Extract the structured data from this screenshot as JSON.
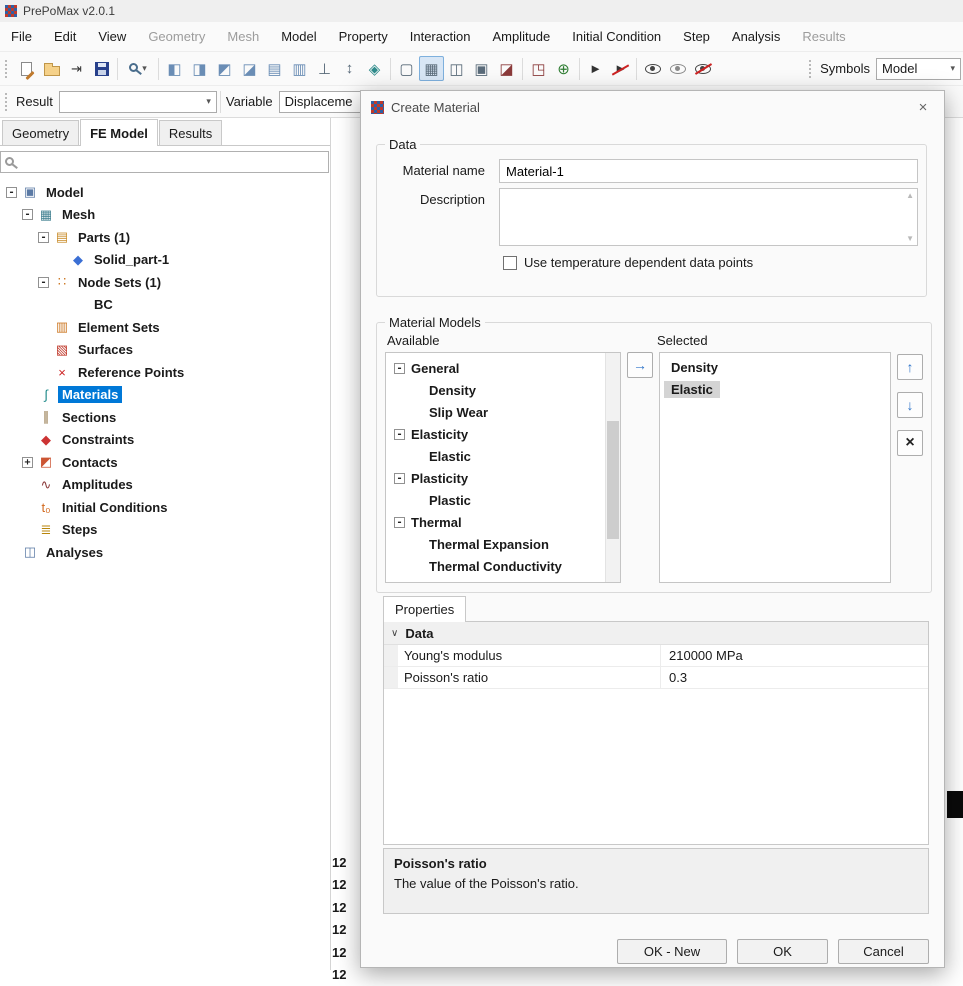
{
  "window": {
    "title": "PrePoMax v2.0.1"
  },
  "colors": {
    "selection_bg": "#0078d7",
    "selection_text": "#ffffff",
    "inactive_selection_bg": "#d4d4d4",
    "toolbar_selected_bg": "#d8e6f5"
  },
  "icons": {
    "app_logo": "css:red-blue-checker",
    "new_file": "css:page-pencil",
    "open_file": "css:folder",
    "import": "⇥",
    "save": "css:floppy",
    "zoom": "css:magnifier",
    "dropdown_caret": "▾",
    "front_view": "◧",
    "back_view": "◨",
    "left_view": "◩",
    "right_view": "◪",
    "top_view": "▤",
    "bottom_view": "▥",
    "normal_view": "⊥",
    "fit_view": "↕",
    "isometric_view": "◈",
    "wireframe_edges": "▢",
    "element_edges": "▦",
    "model_edges": "◫",
    "feature_edges": "▣",
    "section_view": "◪",
    "explode_parts": "◳",
    "query": "⊕",
    "annotate": "►",
    "remove_annotations": "►",
    "show": "css:eye",
    "transparency": "css:eye-faint",
    "hide": "css:eye-slash",
    "search": "css:magnifier",
    "close": "×",
    "scroll_up": "▲",
    "scroll_down": "▼",
    "add_model": "→",
    "move_up": "↑",
    "move_down": "↓",
    "delete_model": "×",
    "category_collapse": "∨"
  },
  "menu": {
    "items": [
      {
        "label": "File",
        "disabled": false
      },
      {
        "label": "Edit",
        "disabled": false
      },
      {
        "label": "View",
        "disabled": false
      },
      {
        "label": "Geometry",
        "disabled": true
      },
      {
        "label": "Mesh",
        "disabled": true
      },
      {
        "label": "Model",
        "disabled": false
      },
      {
        "label": "Property",
        "disabled": false
      },
      {
        "label": "Interaction",
        "disabled": false
      },
      {
        "label": "Amplitude",
        "disabled": false
      },
      {
        "label": "Initial Condition",
        "disabled": false
      },
      {
        "label": "Step",
        "disabled": false
      },
      {
        "label": "Analysis",
        "disabled": false
      },
      {
        "label": "Results",
        "disabled": true
      }
    ]
  },
  "toolbar": {
    "symbols_label": "Symbols",
    "symbols_combo_value": "Model"
  },
  "toolbar2": {
    "result_label": "Result",
    "result_combo_value": "",
    "variable_label": "Variable",
    "variable_combo_value": "Displaceme"
  },
  "sidebar": {
    "tabs": [
      {
        "label": "Geometry",
        "active": false
      },
      {
        "label": "FE Model",
        "active": true
      },
      {
        "label": "Results",
        "active": false
      }
    ],
    "search_value": "",
    "tree": [
      {
        "label": "Model",
        "depth": 0,
        "exp": "-",
        "glyph": "▣",
        "color": "#5b7aa5",
        "selected": false
      },
      {
        "label": "Mesh",
        "depth": 1,
        "exp": "-",
        "glyph": "▦",
        "color": "#3f7f8f",
        "selected": false
      },
      {
        "label": "Parts (1)",
        "depth": 2,
        "exp": "-",
        "glyph": "▤",
        "color": "#c98c2a",
        "selected": false
      },
      {
        "label": "Solid_part-1",
        "depth": 3,
        "exp": "",
        "glyph": "◆",
        "color": "#3b6fd4",
        "selected": false
      },
      {
        "label": "Node Sets (1)",
        "depth": 2,
        "exp": "-",
        "glyph": "∷",
        "color": "#cc7722",
        "selected": false
      },
      {
        "label": "BC",
        "depth": 3,
        "exp": "",
        "glyph": "",
        "color": "",
        "selected": false
      },
      {
        "label": "Element Sets",
        "depth": 2,
        "exp": "",
        "glyph": "▥",
        "color": "#cc7722",
        "selected": false
      },
      {
        "label": "Surfaces",
        "depth": 2,
        "exp": "",
        "glyph": "▧",
        "color": "#c0392b",
        "selected": false
      },
      {
        "label": "Reference Points",
        "depth": 2,
        "exp": "",
        "glyph": "×",
        "color": "#cc2222",
        "selected": false
      },
      {
        "label": "Materials",
        "depth": 1,
        "exp": "",
        "glyph": "∫",
        "color": "#1f8a8a",
        "selected": true
      },
      {
        "label": "Sections",
        "depth": 1,
        "exp": "",
        "glyph": "∥",
        "color": "#8a6d3b",
        "selected": false
      },
      {
        "label": "Constraints",
        "depth": 1,
        "exp": "",
        "glyph": "◆",
        "color": "#cc3333",
        "selected": false
      },
      {
        "label": "Contacts",
        "depth": 1,
        "exp": "+",
        "glyph": "◩",
        "color": "#cc5533",
        "selected": false
      },
      {
        "label": "Amplitudes",
        "depth": 1,
        "exp": "",
        "glyph": "∿",
        "color": "#8b3a3a",
        "selected": false
      },
      {
        "label": "Initial Conditions",
        "depth": 1,
        "exp": "",
        "glyph": "t₀",
        "color": "#d2691e",
        "selected": false
      },
      {
        "label": "Steps",
        "depth": 1,
        "exp": "",
        "glyph": "≣",
        "color": "#b8860b",
        "selected": false
      },
      {
        "label": "Analyses",
        "depth": 0,
        "exp": "",
        "glyph": "◫",
        "color": "#5b7aa5",
        "selected": false
      }
    ]
  },
  "background": {
    "line_numbers": [
      "12",
      "12",
      "12",
      "12",
      "12",
      "12"
    ]
  },
  "dialog": {
    "title": "Create Material",
    "data_group": {
      "legend": "Data",
      "material_name_label": "Material name",
      "material_name_value": "Material-1",
      "description_label": "Description",
      "description_value": "",
      "checkbox_label": "Use temperature dependent data points",
      "checkbox_checked": false
    },
    "models_group": {
      "legend": "Material Models",
      "available_label": "Available",
      "selected_label": "Selected",
      "available_tree": [
        {
          "label": "General",
          "depth": 0,
          "exp": "-"
        },
        {
          "label": "Density",
          "depth": 1,
          "exp": ""
        },
        {
          "label": "Slip Wear",
          "depth": 1,
          "exp": ""
        },
        {
          "label": "Elasticity",
          "depth": 0,
          "exp": "-"
        },
        {
          "label": "Elastic",
          "depth": 1,
          "exp": ""
        },
        {
          "label": "Plasticity",
          "depth": 0,
          "exp": "-"
        },
        {
          "label": "Plastic",
          "depth": 1,
          "exp": ""
        },
        {
          "label": "Thermal",
          "depth": 0,
          "exp": "-"
        },
        {
          "label": "Thermal Expansion",
          "depth": 1,
          "exp": ""
        },
        {
          "label": "Thermal Conductivity",
          "depth": 1,
          "exp": ""
        }
      ],
      "selected_items": [
        {
          "label": "Density",
          "selected": false
        },
        {
          "label": "Elastic",
          "selected": true
        }
      ]
    },
    "properties": {
      "tab_label": "Properties",
      "category_label": "Data",
      "rows": [
        {
          "name": "Young's modulus",
          "value": "210000 MPa"
        },
        {
          "name": "Poisson's ratio",
          "value": "0.3"
        }
      ],
      "help_title": "Poisson's ratio",
      "help_text": "The value of the Poisson's ratio."
    },
    "buttons": {
      "ok_new": "OK - New",
      "ok": "OK",
      "cancel": "Cancel"
    }
  }
}
